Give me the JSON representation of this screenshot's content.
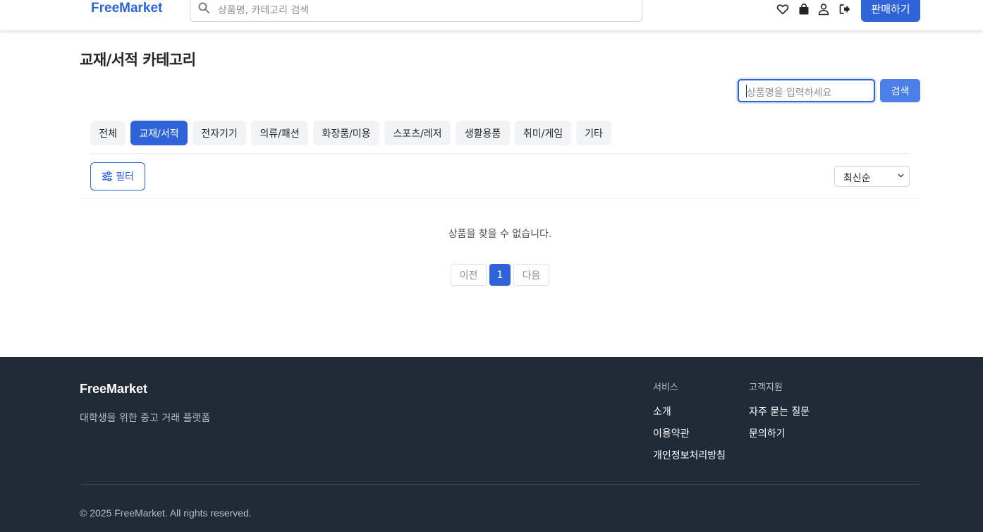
{
  "header": {
    "brand": "FreeMarket",
    "search_placeholder": "상품명, 카테고리 검색",
    "sell_label": "판매하기"
  },
  "page": {
    "title": "교재/서적 카테고리"
  },
  "category_search": {
    "placeholder": "상품명을 입력하세요",
    "button_label": "검색"
  },
  "tabs": [
    {
      "label": "전체",
      "active": false
    },
    {
      "label": "교재/서적",
      "active": true
    },
    {
      "label": "전자기기",
      "active": false
    },
    {
      "label": "의류/패션",
      "active": false
    },
    {
      "label": "화장품/미용",
      "active": false
    },
    {
      "label": "스포츠/레저",
      "active": false
    },
    {
      "label": "생활용품",
      "active": false
    },
    {
      "label": "취미/게임",
      "active": false
    },
    {
      "label": "기타",
      "active": false
    }
  ],
  "toolbar": {
    "filter_label": "필터",
    "sort_selected": "최신순"
  },
  "results": {
    "empty_message": "상품을 찾을 수 없습니다."
  },
  "pagination": {
    "prev_label": "이전",
    "current_page": "1",
    "next_label": "다음"
  },
  "footer": {
    "brand": "FreeMarket",
    "description": "대학생을 위한 중고 거래 플랫폼",
    "service_heading": "서비스",
    "service_links": [
      "소개",
      "이용약관",
      "개인정보처리방침"
    ],
    "support_heading": "고객지원",
    "support_links": [
      "자주 묻는 질문",
      "문의하기"
    ],
    "copyright": "© 2025 FreeMarket. All rights reserved."
  },
  "colors": {
    "accent": "#2f63d8",
    "footer_bg": "#212a37"
  }
}
